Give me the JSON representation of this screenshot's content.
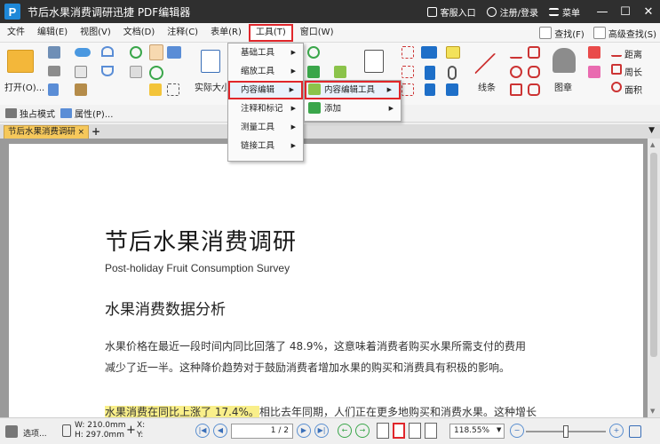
{
  "window": {
    "title": "节后水果消费调研迅捷 PDF编辑器",
    "logo_letter": "P",
    "customer_service": "客服入口",
    "register_login": "注册/登录",
    "menu": "菜单"
  },
  "menubar": {
    "items": [
      "文件",
      "编辑(E)",
      "视图(V)",
      "文档(D)",
      "注释(C)",
      "表单(R)",
      "工具(T)",
      "窗口(W)"
    ],
    "right": [
      "查找(F)",
      "高级查找(S)"
    ]
  },
  "ribbon": {
    "open": "打开(O)...",
    "actual_size": "实际大小",
    "line": "线条",
    "stamp": "图章",
    "distance": "距离",
    "perimeter": "周长",
    "area": "面积"
  },
  "subbar": {
    "exclusive_mode": "独占模式",
    "properties": "属性(P)..."
  },
  "tabs": {
    "active": "节后水果消费调研",
    "close": "×",
    "add": "+"
  },
  "tools_menu": {
    "items": [
      {
        "label": "基础工具"
      },
      {
        "label": "缩放工具"
      },
      {
        "label": "内容编辑"
      },
      {
        "label": "注释和标记"
      },
      {
        "label": "测量工具"
      },
      {
        "label": "链接工具"
      }
    ]
  },
  "content_edit_submenu": {
    "items": [
      {
        "label": "内容编辑工具"
      },
      {
        "label": "添加"
      }
    ]
  },
  "document": {
    "title": "节后水果消费调研",
    "subtitle": "Post-holiday Fruit Consumption Survey",
    "section_heading": "水果消费数据分析",
    "para1_line1": "水果价格在最近一段时间内同比回落了  48.9%，这意味着消费者购买水果所需支付的费用",
    "para1_line2": "减少了近一半。这种降价趋势对于鼓励消费者增加水果的购买和消费具有积极的影响。",
    "para2_highlight": "水果消费在同比上涨了 17.4%。",
    "para2_rest": "相比去年同期，人们正在更多地购买和消费水果。这种增长"
  },
  "statusbar": {
    "select": "选项...",
    "width": "W: 210.0mm",
    "height": "H: 297.0mm",
    "x_label": "X:",
    "y_label": "Y:",
    "page": "1 / 2",
    "zoom": "118.55%"
  }
}
